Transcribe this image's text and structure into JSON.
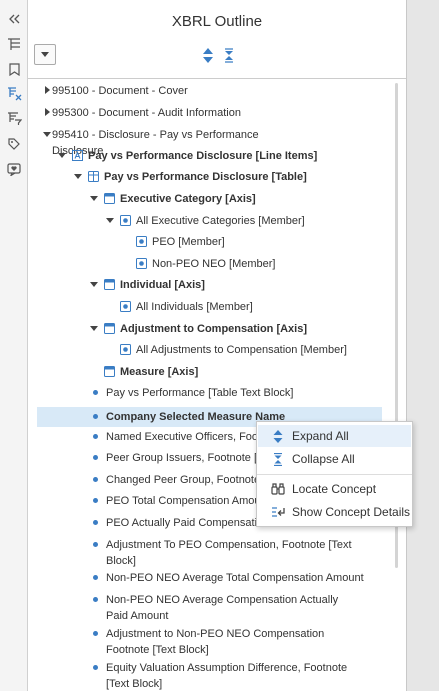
{
  "panel": {
    "title": "XBRL Outline"
  },
  "tree": [
    {
      "label": "995100 - Document - Cover",
      "caret": "right",
      "icon": "none",
      "bold": false
    },
    {
      "label": "995300 - Document - Audit Information",
      "caret": "right",
      "icon": "none",
      "bold": false
    },
    {
      "label": "995410 - Disclosure - Pay vs Performance Disclosure",
      "caret": "down",
      "icon": "none",
      "bold": false
    },
    {
      "label": "Pay vs Performance Disclosure [Line Items]",
      "caret": "down",
      "icon": "abstract",
      "bold": true
    },
    {
      "label": "Pay vs Performance Disclosure [Table]",
      "caret": "down",
      "icon": "table",
      "bold": true
    },
    {
      "label": "Executive Category [Axis]",
      "caret": "down",
      "icon": "axis",
      "bold": true
    },
    {
      "label": "All Executive Categories [Member]",
      "caret": "down",
      "icon": "member",
      "bold": false
    },
    {
      "label": "PEO [Member]",
      "caret": "none",
      "icon": "member",
      "bold": false
    },
    {
      "label": "Non-PEO NEO [Member]",
      "caret": "none",
      "icon": "member",
      "bold": false
    },
    {
      "label": "Individual [Axis]",
      "caret": "down",
      "icon": "axis",
      "bold": true
    },
    {
      "label": "All Individuals [Member]",
      "caret": "none",
      "icon": "member",
      "bold": false
    },
    {
      "label": "Adjustment to Compensation [Axis]",
      "caret": "down",
      "icon": "axis",
      "bold": true
    },
    {
      "label": "All Adjustments to Compensation [Member]",
      "caret": "none",
      "icon": "member",
      "bold": false
    },
    {
      "label": "Measure [Axis]",
      "caret": "none",
      "icon": "axis",
      "bold": true
    },
    {
      "label": "Pay vs Performance [Table Text Block]",
      "caret": "none",
      "icon": "dot",
      "bold": false
    },
    {
      "label": "Company Selected Measure Name",
      "caret": "none",
      "icon": "dot",
      "bold": true,
      "selected": true
    },
    {
      "label": "Named Executive Officers, Foot",
      "caret": "none",
      "icon": "dot",
      "bold": false
    },
    {
      "label": "Peer Group Issuers, Footnote [T",
      "caret": "none",
      "icon": "dot",
      "bold": false
    },
    {
      "label": "Changed Peer Group, Footnote",
      "caret": "none",
      "icon": "dot",
      "bold": false
    },
    {
      "label": "PEO Total Compensation Amou",
      "caret": "none",
      "icon": "dot",
      "bold": false
    },
    {
      "label": "PEO Actually Paid Compensatio",
      "caret": "none",
      "icon": "dot",
      "bold": false
    },
    {
      "label": "Adjustment To PEO Compensation, Footnote [Text Block]",
      "caret": "none",
      "icon": "dot",
      "bold": false
    },
    {
      "label": "Non-PEO NEO Average Total Compensation Amount",
      "caret": "none",
      "icon": "dot",
      "bold": false
    },
    {
      "label": "Non-PEO NEO Average Compensation Actually Paid Amount",
      "caret": "none",
      "icon": "dot",
      "bold": false
    },
    {
      "label": "Adjustment to Non-PEO NEO Compensation Footnote [Text Block]",
      "caret": "none",
      "icon": "dot",
      "bold": false
    },
    {
      "label": "Equity Valuation Assumption Difference, Footnote [Text Block]",
      "caret": "none",
      "icon": "dot",
      "bold": false
    }
  ],
  "context_menu": {
    "expand_all": "Expand All",
    "collapse_all": "Collapse All",
    "locate_concept": "Locate Concept",
    "show_concept_details": "Show Concept Details"
  },
  "colors": {
    "accent": "#3a7dc4",
    "selection": "#d8e9f7"
  }
}
